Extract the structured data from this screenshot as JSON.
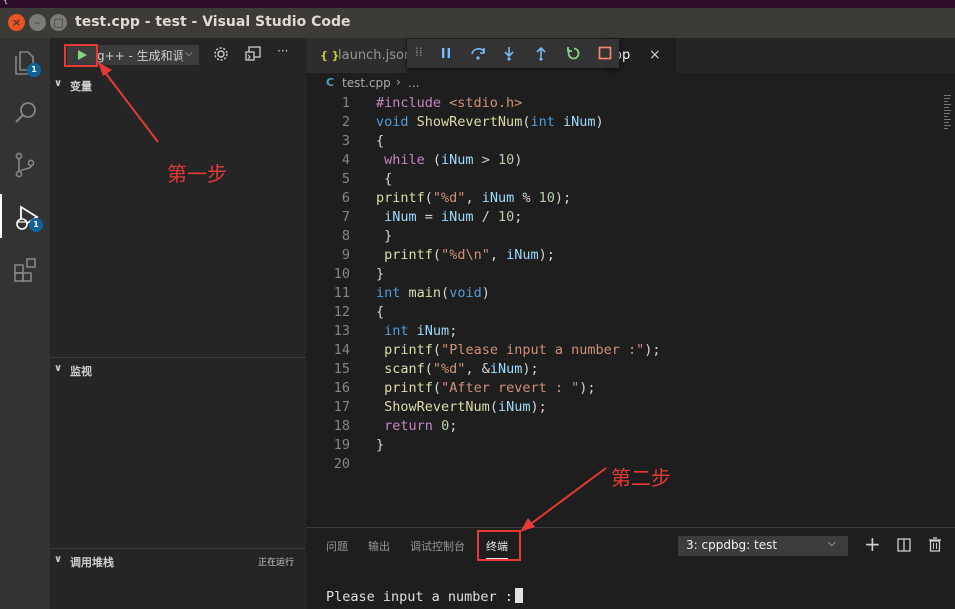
{
  "window": {
    "title": "test.cpp - test - Visual Studio Code",
    "close_glyph": "×",
    "min_glyph": "–",
    "max_glyph": "□",
    "stray_glyph": "{"
  },
  "activity_bar": {
    "items": [
      {
        "name": "explorer",
        "badge": "1"
      },
      {
        "name": "search"
      },
      {
        "name": "source-control"
      },
      {
        "name": "run-debug",
        "badge": "1",
        "active": true
      },
      {
        "name": "extensions"
      }
    ]
  },
  "debug_toolbar": {
    "config_name": "g++ - 生成和调",
    "chevron": "⌵",
    "more": "···"
  },
  "sidebar": {
    "variables_header": "变量",
    "watch_header": "监视",
    "callstack_header": "调用堆栈",
    "callstack_status": "正在运行",
    "expand_arrow": "∨"
  },
  "annotations": {
    "step1": "第一步",
    "step2": "第二步"
  },
  "editor": {
    "tabs": [
      {
        "icon": "{ }",
        "label": "launch.json"
      },
      {
        "label": "op",
        "close": "×"
      }
    ],
    "breadcrumb": {
      "icon": "C",
      "file": "test.cpp",
      "separator": "›",
      "rest": "..."
    },
    "float_debug": {
      "grip": "⁞⁞"
    }
  },
  "code_lines": [
    {
      "n": "1",
      "t": "#include <stdio.h>"
    },
    {
      "n": "2",
      "t": "void ShowRevertNum(int iNum)"
    },
    {
      "n": "3",
      "t": "{"
    },
    {
      "n": "4",
      "t": " while (iNum > 10)"
    },
    {
      "n": "5",
      "t": " {"
    },
    {
      "n": "6",
      "t": "printf(\"%d\", iNum % 10);"
    },
    {
      "n": "7",
      "t": " iNum = iNum / 10;"
    },
    {
      "n": "8",
      "t": " }"
    },
    {
      "n": "9",
      "t": " printf(\"%d\\n\", iNum);"
    },
    {
      "n": "10",
      "t": "}"
    },
    {
      "n": "11",
      "t": "int main(void)"
    },
    {
      "n": "12",
      "t": "{"
    },
    {
      "n": "13",
      "t": " int iNum;"
    },
    {
      "n": "14",
      "t": " printf(\"Please input a number :\");"
    },
    {
      "n": "15",
      "t": " scanf(\"%d\", &iNum);"
    },
    {
      "n": "16",
      "t": " printf(\"After revert : \");"
    },
    {
      "n": "17",
      "t": " ShowRevertNum(iNum);"
    },
    {
      "n": "18",
      "t": " return 0;"
    },
    {
      "n": "19",
      "t": "}"
    },
    {
      "n": "20",
      "t": ""
    }
  ],
  "panel": {
    "tabs": [
      "问题",
      "输出",
      "调试控制台",
      "终端"
    ],
    "active_tab": "终端",
    "terminal_select": "3: cppdbg: test",
    "select_chevron": "⌵",
    "add": "+",
    "terminal_output": "Please input a number :"
  },
  "colors": {
    "accent_red": "#e53935",
    "badge_blue": "#0e639c",
    "play_green": "#89d185"
  }
}
